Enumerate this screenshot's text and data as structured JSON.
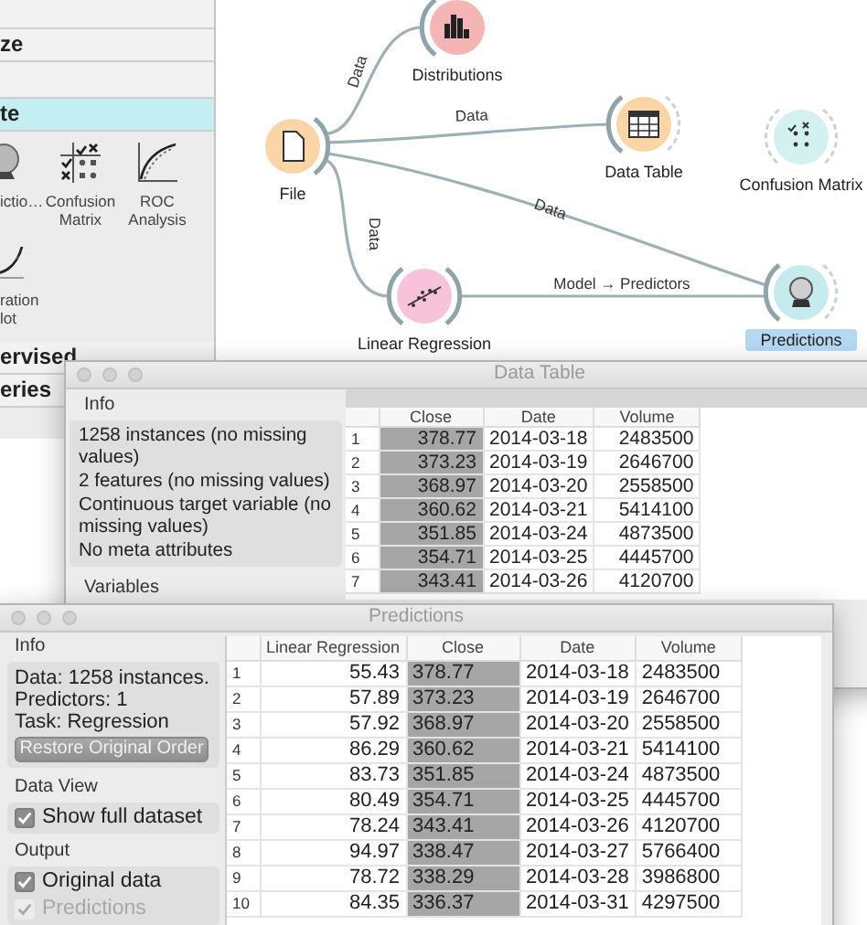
{
  "sidebar": {
    "categories": [
      {
        "label": "ze",
        "expanded": false
      },
      {
        "label": "te",
        "expanded": true,
        "widgets": [
          {
            "lines": [
              "ictio…"
            ],
            "kind": "predictions"
          },
          {
            "lines": [
              "Confusion",
              "Matrix"
            ],
            "kind": "confusion"
          },
          {
            "lines": [
              "ROC",
              "Analysis"
            ],
            "kind": "roc"
          },
          {
            "lines": [
              "ration",
              "lot"
            ],
            "kind": "calibration"
          }
        ]
      },
      {
        "label": "ervised",
        "expanded": false
      },
      {
        "label": "eries",
        "expanded": false
      }
    ]
  },
  "canvas": {
    "nodes": [
      {
        "label": "Distributions",
        "kind": "distributions",
        "color": "#f5b5b5",
        "selected": false
      },
      {
        "label": "File",
        "kind": "file",
        "color": "#fcd5a6",
        "selected": false
      },
      {
        "label": "Data Table",
        "kind": "table",
        "color": "#fcd5a6",
        "selected": false
      },
      {
        "label": "Confusion Matrix",
        "kind": "confusion",
        "color": "#d3f1f1",
        "selected": false
      },
      {
        "label": "Linear Regression",
        "kind": "regression",
        "color": "#f6c3da",
        "selected": false
      },
      {
        "label": "Predictions",
        "kind": "predictions",
        "color": "#c6ebee",
        "selected": true
      }
    ],
    "links": [
      {
        "label": "Data"
      },
      {
        "label": "Data"
      },
      {
        "label": "Data"
      },
      {
        "label": "Data"
      },
      {
        "label": "Model → Predictors"
      }
    ]
  },
  "data_table_window": {
    "title": "Data Table",
    "info_heading": "Info",
    "info_lines": [
      "1258 instances (no missing values)",
      "2 features (no missing values)",
      "Continuous target variable (no missing values)",
      "No meta attributes"
    ],
    "variables_heading": "Variables",
    "table": {
      "columns": [
        {
          "label": "Close",
          "shaded": true
        },
        {
          "label": "Date"
        },
        {
          "label": "Volume"
        }
      ],
      "rows": [
        {
          "index": "1",
          "cells": [
            "378.77",
            "2014-03-18",
            "2483500"
          ]
        },
        {
          "index": "2",
          "cells": [
            "373.23",
            "2014-03-19",
            "2646700"
          ]
        },
        {
          "index": "3",
          "cells": [
            "368.97",
            "2014-03-20",
            "2558500"
          ]
        },
        {
          "index": "4",
          "cells": [
            "360.62",
            "2014-03-21",
            "5414100"
          ]
        },
        {
          "index": "5",
          "cells": [
            "351.85",
            "2014-03-24",
            "4873500"
          ]
        },
        {
          "index": "6",
          "cells": [
            "354.71",
            "2014-03-25",
            "4445700"
          ]
        },
        {
          "index": "7",
          "cells": [
            "343.41",
            "2014-03-26",
            "4120700"
          ]
        }
      ]
    }
  },
  "predictions_window": {
    "title": "Predictions",
    "info_heading": "Info",
    "info_lines": [
      "Data: 1258 instances.",
      "Predictors: 1",
      "Task: Regression"
    ],
    "restore_button": {
      "label": "Restore Original Order",
      "disabled": true
    },
    "data_view_heading": "Data View",
    "data_view_options": [
      {
        "label": "Show full dataset",
        "checked": true,
        "disabled": false
      }
    ],
    "output_heading": "Output",
    "output_options": [
      {
        "label": "Original data",
        "checked": true,
        "disabled": false
      },
      {
        "label": "Predictions",
        "checked": true,
        "disabled": true
      }
    ],
    "table": {
      "columns": [
        {
          "label": "Linear Regression"
        },
        {
          "label": "Close",
          "shaded": true
        },
        {
          "label": "Date"
        },
        {
          "label": "Volume"
        }
      ],
      "rows": [
        {
          "index": "1",
          "cells": [
            "55.43",
            "378.77",
            "2014-03-18",
            "2483500"
          ]
        },
        {
          "index": "2",
          "cells": [
            "57.89",
            "373.23",
            "2014-03-19",
            "2646700"
          ]
        },
        {
          "index": "3",
          "cells": [
            "57.92",
            "368.97",
            "2014-03-20",
            "2558500"
          ]
        },
        {
          "index": "4",
          "cells": [
            "86.29",
            "360.62",
            "2014-03-21",
            "5414100"
          ]
        },
        {
          "index": "5",
          "cells": [
            "83.73",
            "351.85",
            "2014-03-24",
            "4873500"
          ]
        },
        {
          "index": "6",
          "cells": [
            "80.49",
            "354.71",
            "2014-03-25",
            "4445700"
          ]
        },
        {
          "index": "7",
          "cells": [
            "78.24",
            "343.41",
            "2014-03-26",
            "4120700"
          ]
        },
        {
          "index": "8",
          "cells": [
            "94.97",
            "338.47",
            "2014-03-27",
            "5766400"
          ]
        },
        {
          "index": "9",
          "cells": [
            "78.72",
            "338.29",
            "2014-03-28",
            "3986800"
          ]
        },
        {
          "index": "10",
          "cells": [
            "84.35",
            "336.37",
            "2014-03-31",
            "4297500"
          ]
        }
      ]
    }
  }
}
